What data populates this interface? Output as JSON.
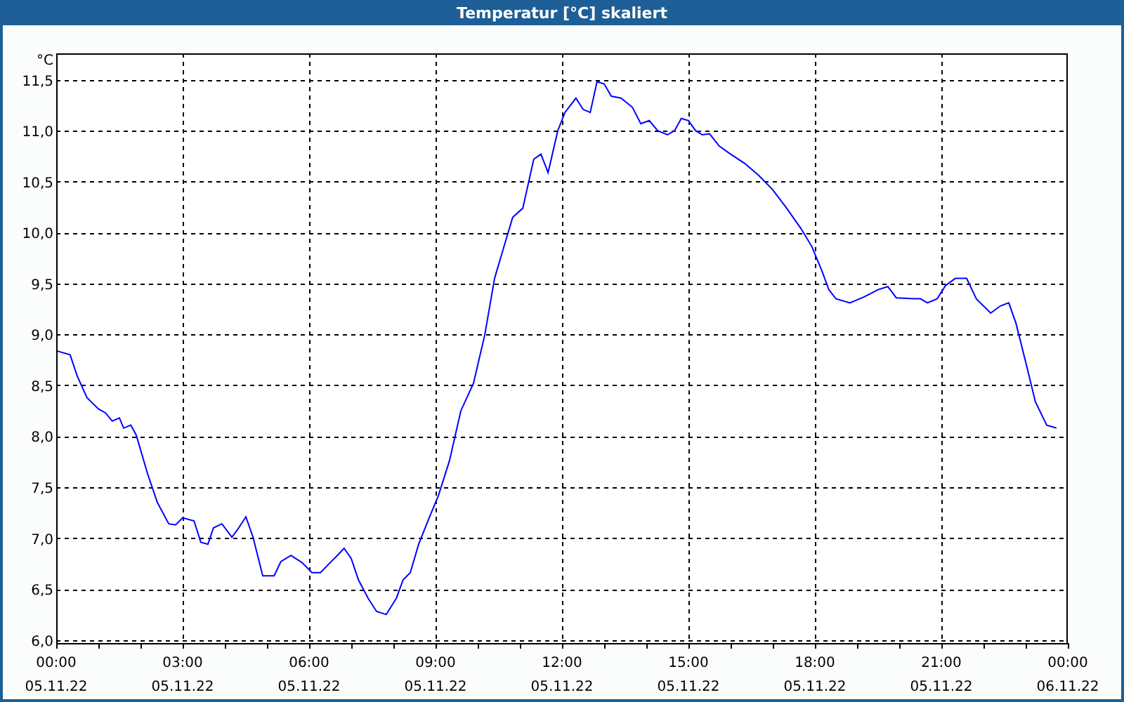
{
  "window": {
    "title": "Temperatur [°C] skaliert"
  },
  "chart": {
    "x_dates": [
      "05.11.22",
      "05.11.22",
      "05.11.22",
      "05.11.22",
      "05.11.22",
      "05.11.22",
      "05.11.22",
      "05.11.22",
      "06.11.22"
    ],
    "chart_data": {
      "type": "line",
      "grid": true,
      "ylabel": "°C",
      "xlim": [
        0,
        24
      ],
      "ylim": [
        5.97,
        11.76
      ],
      "xticks": [
        {
          "value": 0,
          "label": "00:00"
        },
        {
          "value": 3,
          "label": "03:00"
        },
        {
          "value": 6,
          "label": "06:00"
        },
        {
          "value": 9,
          "label": "09:00"
        },
        {
          "value": 12,
          "label": "12:00"
        },
        {
          "value": 15,
          "label": "15:00"
        },
        {
          "value": 18,
          "label": "18:00"
        },
        {
          "value": 21,
          "label": "21:00"
        },
        {
          "value": 24,
          "label": "00:00"
        }
      ],
      "yticks": [
        {
          "value": 6,
          "label": "6,0"
        },
        {
          "value": 6.5,
          "label": "6,5"
        },
        {
          "value": 7,
          "label": "7,0"
        },
        {
          "value": 7.5,
          "label": "7,5"
        },
        {
          "value": 8,
          "label": "8,0"
        },
        {
          "value": 8.5,
          "label": "8,5"
        },
        {
          "value": 9,
          "label": "9,0"
        },
        {
          "value": 9.5,
          "label": "9,5"
        },
        {
          "value": 10,
          "label": "10,0"
        },
        {
          "value": 10.5,
          "label": "10,5"
        },
        {
          "value": 11,
          "label": "11,0"
        },
        {
          "value": 11.5,
          "label": "11,5"
        }
      ],
      "x": [
        0,
        0.33,
        0.5,
        0.73,
        1,
        1.17,
        1.33,
        1.5,
        1.6,
        1.77,
        1.9,
        2.17,
        2.4,
        2.67,
        2.83,
        3,
        3.27,
        3.43,
        3.6,
        3.73,
        3.93,
        4.17,
        4.33,
        4.5,
        4.67,
        4.9,
        5.17,
        5.33,
        5.57,
        5.83,
        6.07,
        6.27,
        6.5,
        6.67,
        6.83,
        7,
        7.17,
        7.4,
        7.6,
        7.83,
        8.07,
        8.23,
        8.4,
        8.6,
        8.83,
        9.07,
        9.33,
        9.6,
        9.9,
        10.17,
        10.4,
        10.6,
        10.83,
        11.07,
        11.33,
        11.5,
        11.67,
        11.9,
        12.07,
        12.33,
        12.5,
        12.67,
        12.83,
        13,
        13.17,
        13.4,
        13.67,
        13.87,
        14.07,
        14.27,
        14.5,
        14.67,
        14.83,
        15,
        15.17,
        15.33,
        15.5,
        15.73,
        16,
        16.33,
        16.67,
        17,
        17.33,
        17.67,
        17.93,
        18.17,
        18.33,
        18.5,
        18.83,
        19.17,
        19.5,
        19.73,
        19.93,
        20.33,
        20.5,
        20.67,
        20.9,
        21.1,
        21.33,
        21.6,
        21.83,
        22.17,
        22.4,
        22.6,
        22.77,
        23,
        23.23,
        23.5,
        23.73
      ],
      "series": [
        {
          "color": "#0000ff",
          "values": [
            8.84,
            8.8,
            8.59,
            8.38,
            8.27,
            8.23,
            8.15,
            8.18,
            8.08,
            8.11,
            8.01,
            7.63,
            7.35,
            7.14,
            7.13,
            7.2,
            7.17,
            6.96,
            6.94,
            7.1,
            7.14,
            7.01,
            7.1,
            7.21,
            7.01,
            6.63,
            6.63,
            6.77,
            6.83,
            6.76,
            6.66,
            6.66,
            6.76,
            6.83,
            6.9,
            6.8,
            6.59,
            6.41,
            6.28,
            6.25,
            6.41,
            6.59,
            6.66,
            6.94,
            7.18,
            7.42,
            7.76,
            8.25,
            8.52,
            9.0,
            9.55,
            9.83,
            10.15,
            10.24,
            10.72,
            10.77,
            10.59,
            11.0,
            11.18,
            11.32,
            11.21,
            11.18,
            11.48,
            11.46,
            11.34,
            11.32,
            11.23,
            11.07,
            11.1,
            11.0,
            10.96,
            11.0,
            11.12,
            11.1,
            11.0,
            10.96,
            10.97,
            10.85,
            10.77,
            10.68,
            10.56,
            10.42,
            10.24,
            10.04,
            9.86,
            9.62,
            9.44,
            9.35,
            9.31,
            9.37,
            9.44,
            9.47,
            9.36,
            9.35,
            9.35,
            9.31,
            9.35,
            9.48,
            9.55,
            9.55,
            9.35,
            9.21,
            9.28,
            9.31,
            9.11,
            8.73,
            8.34,
            8.11,
            8.08
          ]
        }
      ]
    }
  }
}
